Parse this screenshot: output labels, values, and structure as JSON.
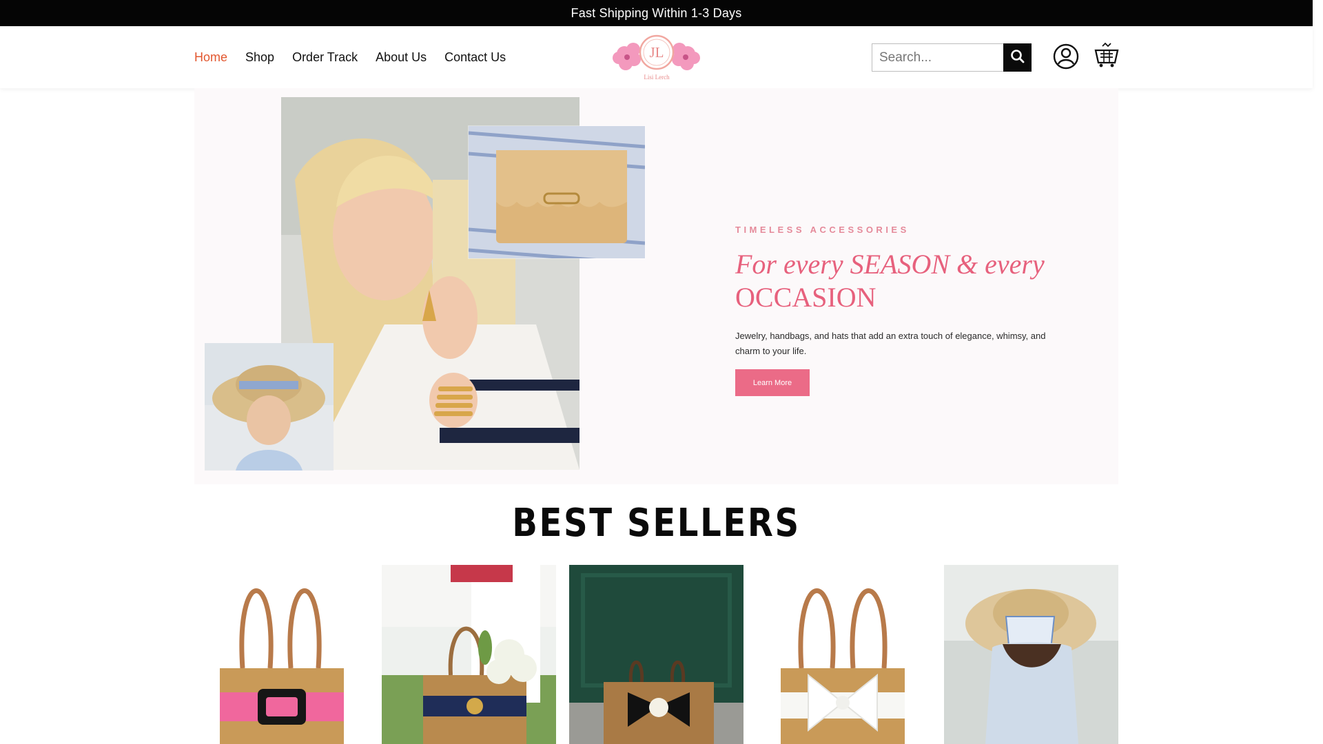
{
  "announcement": {
    "text": "Fast Shipping Within 1-3 Days"
  },
  "nav": {
    "items": [
      {
        "label": "Home",
        "active": true
      },
      {
        "label": "Shop"
      },
      {
        "label": "Order Track"
      },
      {
        "label": "About Us"
      },
      {
        "label": "Contact Us"
      }
    ]
  },
  "logo": {
    "monogram": "JL",
    "name": "Lisi Lerch"
  },
  "search": {
    "placeholder": "Search..."
  },
  "icons": {
    "search": "search-icon",
    "account": "user-icon",
    "cart": "cart-icon"
  },
  "hero": {
    "kicker": "TIMELESS ACCESSORIES",
    "title_line1": "For every SEASON & every",
    "title_line2": "OCCASION",
    "description": "Jewelry, handbags, and hats that add an extra touch of elegance, whimsy, and charm to your life.",
    "button_label": "Learn More"
  },
  "best_sellers": {
    "title": "BEST SELLERS"
  },
  "colors": {
    "accent": "#e2572f",
    "hero_pink": "#e7617d",
    "button_pink": "#eb6b87"
  }
}
